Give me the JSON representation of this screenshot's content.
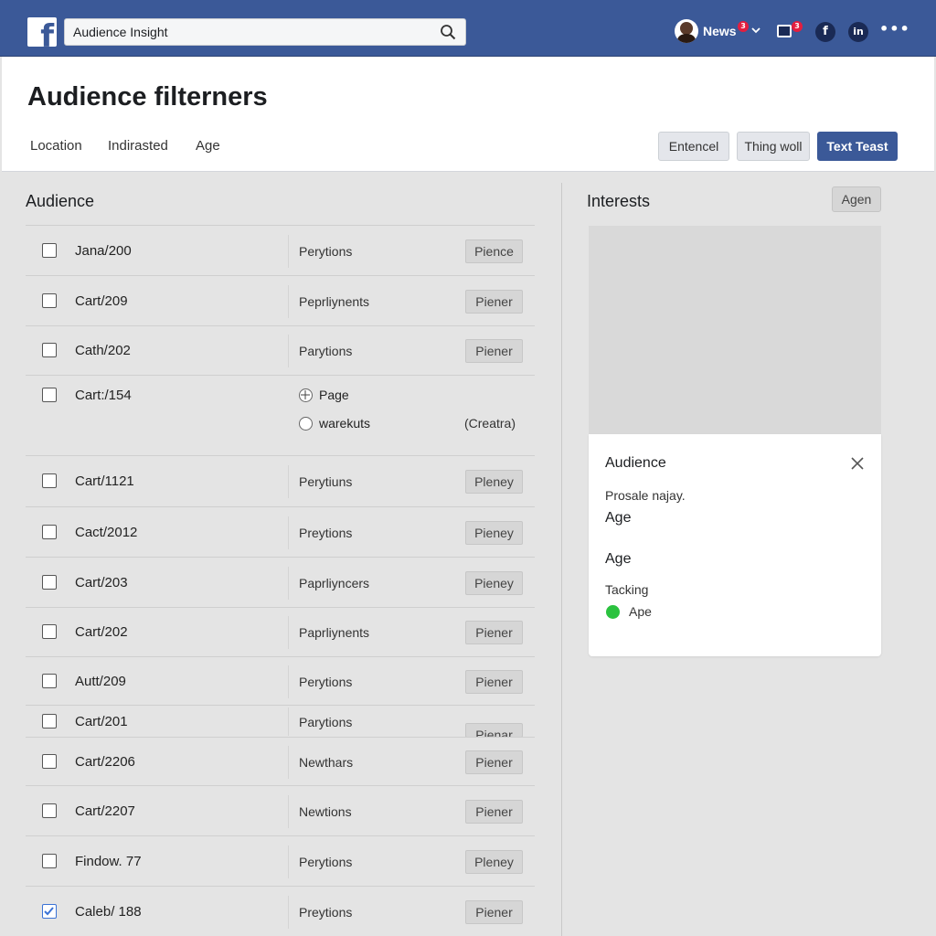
{
  "topbar": {
    "search_value": "Audience Insight",
    "profile_label": "News",
    "news_badge": "3",
    "box_badge": "3",
    "fb_icon_letter": "f",
    "in_icon_letter": "in",
    "more_label": "•••",
    "brand_color": "#3b5998"
  },
  "header": {
    "title": "Audience filterners",
    "tabs": [
      "Location",
      "Indirasted",
      "Age"
    ],
    "buttons": [
      "Entencel",
      "Thing woll",
      "Text Teast"
    ]
  },
  "audience": {
    "title": "Audience",
    "rows": [
      {
        "name": "Jana/200",
        "type": "Perytions",
        "tag": "Pience",
        "checked": false
      },
      {
        "name": "Cart/209",
        "type": "Peprliynents",
        "tag": "Piener",
        "checked": false
      },
      {
        "name": "Cath/202",
        "type": "Parytions",
        "tag": "Piener",
        "checked": false
      },
      {
        "name": "Cart:/154",
        "radio1": "Page",
        "radio2": "warekuts",
        "note": "(Creatra)",
        "checked": false
      },
      {
        "name": "Cart/1121",
        "type": "Perytiuns",
        "tag": "Pleney",
        "checked": false
      },
      {
        "name": "Cact/2012",
        "type": "Preytions",
        "tag": "Pieney",
        "checked": false
      },
      {
        "name": "Cart/203",
        "type": "Paprliyncers",
        "tag": "Pieney",
        "checked": false
      },
      {
        "name": "Cart/202",
        "type": "Paprliynents",
        "tag": "Piener",
        "checked": false
      },
      {
        "name": "Autt/209",
        "type": "Perytions",
        "tag": "Piener",
        "checked": false
      },
      {
        "name": "Cart/201",
        "type": "Parytions",
        "tag": "Pienar",
        "checked": false
      },
      {
        "name": "Cart/2206",
        "type": "Newthars",
        "tag": "Piener",
        "checked": false
      },
      {
        "name": "Cart/2207",
        "type": "Newtions",
        "tag": "Piener",
        "checked": false
      },
      {
        "name": "Findow. 77",
        "type": "Perytions",
        "tag": "Pleney",
        "checked": false
      },
      {
        "name": "Caleb/ 188",
        "type": "Preytions",
        "tag": "Piener",
        "checked": true
      }
    ]
  },
  "interests": {
    "title": "Interests",
    "button": "Agen",
    "card": {
      "title": "Audience",
      "line1": "Prosale najay.",
      "line2": "Age",
      "line3": "Age",
      "line4": "Tacking",
      "status_label": "Ape",
      "status_color": "#2bc23f"
    }
  }
}
